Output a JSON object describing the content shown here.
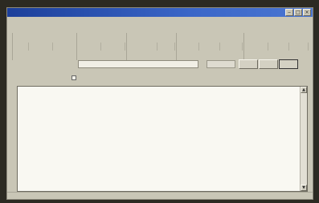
{
  "window": {
    "title": ""
  },
  "menu": [],
  "toolbar_groups": [],
  "fields": {
    "label": "",
    "address_value": "",
    "small_value": ""
  },
  "buttons": [],
  "options": {
    "left": "",
    "check": ""
  },
  "editor": {
    "lines": []
  },
  "status": {
    "text": ""
  },
  "colors": {
    "title_bar": "#2a55b8",
    "window_bg": "#c9c6b6",
    "editor_bg": "#f9f8f2"
  },
  "icons": {
    "minimize": "minimize-icon",
    "maximize": "maximize-icon",
    "close": "close-icon"
  }
}
